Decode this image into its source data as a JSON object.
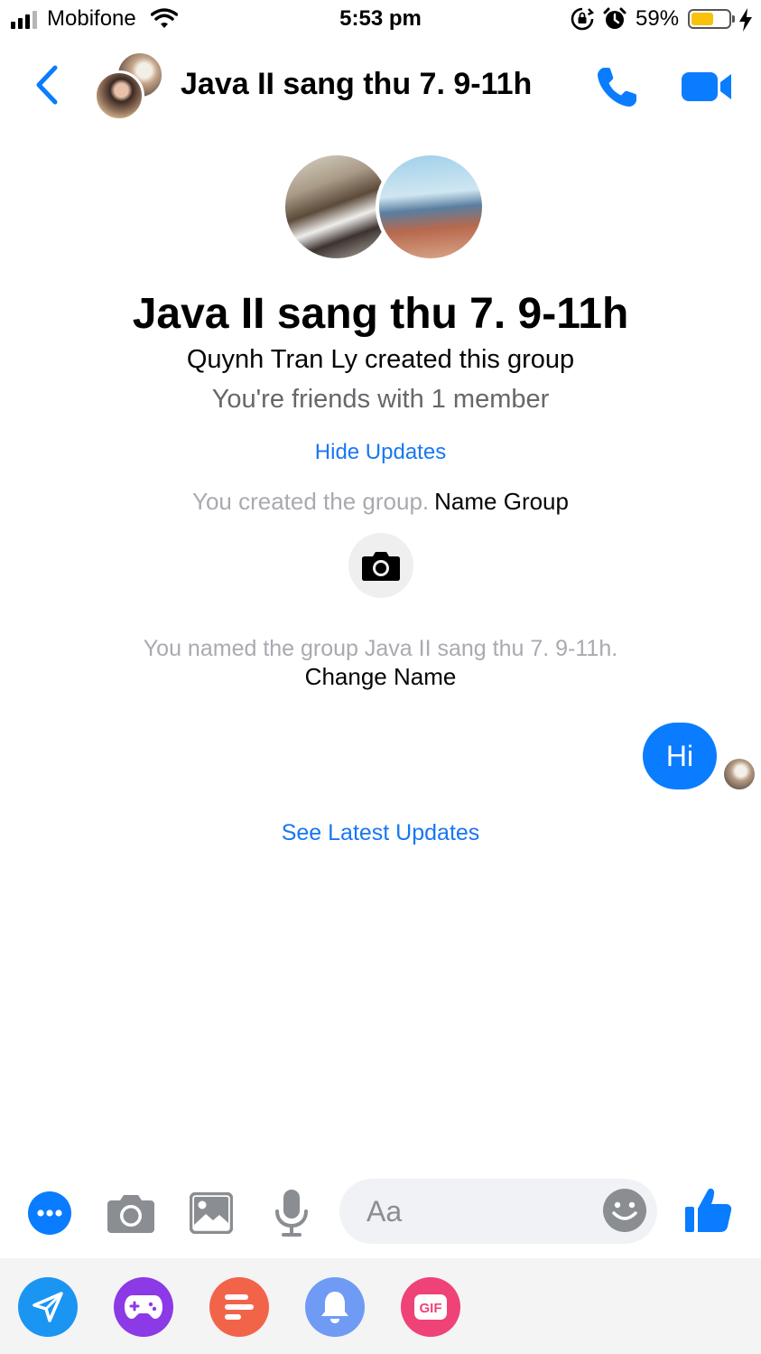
{
  "status_bar": {
    "carrier": "Mobifone",
    "time": "5:53 pm",
    "battery_percent": "59%",
    "battery_level": 0.59,
    "battery_color": "#f7c10c",
    "signal_bars": 4,
    "signal_bars_active": 3
  },
  "header": {
    "title": "Java II sang thu 7. 9-11h",
    "icons": [
      "back-chevron-icon",
      "phone-icon",
      "video-camera-icon"
    ],
    "accent_color": "#0a7cff"
  },
  "intro": {
    "group_name": "Java II sang thu 7. 9-11h",
    "creator_text": "Quynh Tran Ly created this group",
    "friends_text": "You're friends with 1 member",
    "hide_updates": "Hide Updates"
  },
  "events": {
    "created_text": "You created the group.",
    "name_group_link": "Name Group",
    "named_text": "You named the group Java II sang thu 7. 9-11h.",
    "change_name_link": "Change Name"
  },
  "messages": [
    {
      "text": "Hi",
      "outgoing": true,
      "bubble_color": "#0a7cff"
    }
  ],
  "see_latest_updates": "See Latest Updates",
  "composer": {
    "placeholder": "Aa",
    "buttons": [
      "more-icon",
      "camera-icon",
      "gallery-icon",
      "microphone-icon",
      "emoji-icon",
      "thumbs-up-icon"
    ]
  },
  "app_tray": {
    "apps": [
      {
        "icon": "send-icon",
        "color": "#1b95f2"
      },
      {
        "icon": "gamepad-icon",
        "color": "#8b3ae6"
      },
      {
        "icon": "poll-icon",
        "color": "#f2644a"
      },
      {
        "icon": "bell-icon",
        "color": "#6f9bf5"
      },
      {
        "icon": "gif-icon",
        "color": "#ef4277",
        "label": "GIF"
      }
    ]
  }
}
